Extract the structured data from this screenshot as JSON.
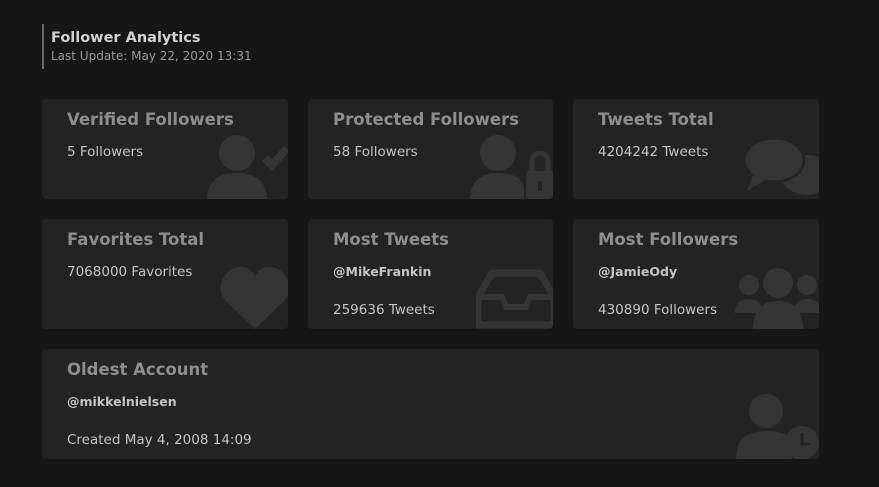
{
  "header": {
    "title": "Follower Analytics",
    "last_update": "Last Update: May 22, 2020 13:31"
  },
  "cards": {
    "verified": {
      "title": "Verified Followers",
      "value": "5 Followers"
    },
    "protected": {
      "title": "Protected Followers",
      "value": "58 Followers"
    },
    "tweets_total": {
      "title": "Tweets Total",
      "value": "4204242 Tweets"
    },
    "favorites_total": {
      "title": "Favorites Total",
      "value": "7068000 Favorites"
    },
    "most_tweets": {
      "title": "Most Tweets",
      "handle": "@MikeFrankin",
      "value": "259636 Tweets"
    },
    "most_followers": {
      "title": "Most Followers",
      "handle": "@JamieOdy",
      "value": "430890 Followers"
    },
    "oldest_account": {
      "title": "Oldest Account",
      "handle": "@mikkelnielsen",
      "value": "Created May 4, 2008 14:09"
    }
  },
  "icons": {
    "verified": "user-check-icon",
    "protected": "user-lock-icon",
    "tweets_total": "comments-icon",
    "favorites_total": "heart-icon",
    "most_tweets": "inbox-icon",
    "most_followers": "users-icon",
    "oldest_account": "user-clock-icon"
  },
  "colors": {
    "background": "#161616",
    "card": "#232323",
    "icon": "#353535"
  }
}
